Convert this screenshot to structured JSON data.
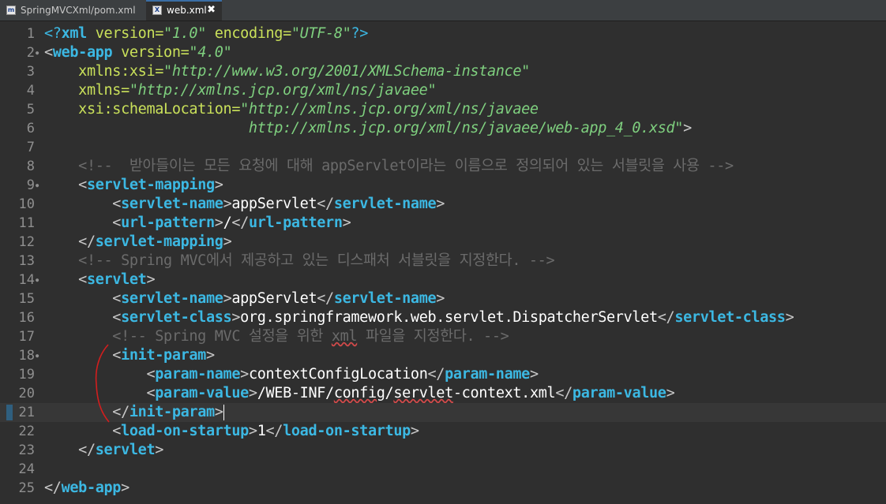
{
  "tabs": [
    {
      "label": "SpringMVCXml/pom.xml",
      "icon": "maven-file-icon"
    },
    {
      "label": "web.xml",
      "icon": "xml-file-icon",
      "close": "✖"
    }
  ],
  "editor": {
    "lines": [
      {
        "n": "1",
        "tokens": [
          {
            "c": "pi",
            "t": "<?"
          },
          {
            "c": "tg",
            "t": "xml"
          },
          {
            "c": "at",
            "t": " version="
          },
          {
            "c": "av",
            "t": "\"1.0\""
          },
          {
            "c": "at",
            "t": " encoding="
          },
          {
            "c": "av",
            "t": "\"UTF-8\""
          },
          {
            "c": "pi",
            "t": "?>"
          }
        ]
      },
      {
        "n": "2",
        "fold": true,
        "tokens": [
          {
            "c": "pu",
            "t": "<"
          },
          {
            "c": "tg",
            "t": "web-app"
          },
          {
            "c": "at",
            "t": " version="
          },
          {
            "c": "av",
            "t": "\"4.0\""
          }
        ]
      },
      {
        "n": "3",
        "tokens": [
          {
            "c": "at",
            "t": "    xmlns:xsi="
          },
          {
            "c": "av",
            "t": "\"http://www.w3.org/2001/XMLSchema-instance\""
          }
        ]
      },
      {
        "n": "4",
        "tokens": [
          {
            "c": "at",
            "t": "    xmlns="
          },
          {
            "c": "av",
            "t": "\"http://xmlns.jcp.org/xml/ns/javaee\""
          }
        ]
      },
      {
        "n": "5",
        "tokens": [
          {
            "c": "at",
            "t": "    xsi:schemaLocation="
          },
          {
            "c": "av",
            "t": "\"http://xmlns.jcp.org/xml/ns/javaee"
          }
        ]
      },
      {
        "n": "6",
        "tokens": [
          {
            "c": "av",
            "t": "                        http://xmlns.jcp.org/xml/ns/javaee/web-app_4_0.xsd\""
          },
          {
            "c": "pu",
            "t": ">"
          }
        ]
      },
      {
        "n": "7",
        "tokens": []
      },
      {
        "n": "8",
        "tokens": [
          {
            "c": "cm",
            "t": "    <!--  받아들이는 모든 요청에 대해 appServlet이라는 이름으로 정의되어 있는 서블릿을 사용 -->"
          }
        ]
      },
      {
        "n": "9",
        "fold": true,
        "tokens": [
          {
            "c": "pu",
            "t": "    <"
          },
          {
            "c": "tg",
            "t": "servlet-mapping"
          },
          {
            "c": "pu",
            "t": ">"
          }
        ]
      },
      {
        "n": "10",
        "tokens": [
          {
            "c": "pu",
            "t": "        <"
          },
          {
            "c": "tg",
            "t": "servlet-name"
          },
          {
            "c": "pu",
            "t": ">"
          },
          {
            "c": "tx",
            "t": "appServlet"
          },
          {
            "c": "pu",
            "t": "</"
          },
          {
            "c": "tg",
            "t": "servlet-name"
          },
          {
            "c": "pu",
            "t": ">"
          }
        ]
      },
      {
        "n": "11",
        "tokens": [
          {
            "c": "pu",
            "t": "        <"
          },
          {
            "c": "tg",
            "t": "url-pattern"
          },
          {
            "c": "pu",
            "t": ">"
          },
          {
            "c": "tx",
            "t": "/"
          },
          {
            "c": "pu",
            "t": "</"
          },
          {
            "c": "tg",
            "t": "url-pattern"
          },
          {
            "c": "pu",
            "t": ">"
          }
        ]
      },
      {
        "n": "12",
        "tokens": [
          {
            "c": "pu",
            "t": "    </"
          },
          {
            "c": "tg",
            "t": "servlet-mapping"
          },
          {
            "c": "pu",
            "t": ">"
          }
        ]
      },
      {
        "n": "13",
        "tokens": [
          {
            "c": "cm",
            "t": "    <!-- Spring MVC에서 제공하고 있는 디스패처 서블릿을 지정한다. -->"
          }
        ]
      },
      {
        "n": "14",
        "fold": true,
        "tokens": [
          {
            "c": "pu",
            "t": "    <"
          },
          {
            "c": "tg",
            "t": "servlet"
          },
          {
            "c": "pu",
            "t": ">"
          }
        ]
      },
      {
        "n": "15",
        "tokens": [
          {
            "c": "pu",
            "t": "        <"
          },
          {
            "c": "tg",
            "t": "servlet-name"
          },
          {
            "c": "pu",
            "t": ">"
          },
          {
            "c": "tx",
            "t": "appServlet"
          },
          {
            "c": "pu",
            "t": "</"
          },
          {
            "c": "tg",
            "t": "servlet-name"
          },
          {
            "c": "pu",
            "t": ">"
          }
        ]
      },
      {
        "n": "16",
        "tokens": [
          {
            "c": "pu",
            "t": "        <"
          },
          {
            "c": "tg",
            "t": "servlet-class"
          },
          {
            "c": "pu",
            "t": ">"
          },
          {
            "c": "tx",
            "t": "org.springframework.web.servlet.DispatcherServlet"
          },
          {
            "c": "pu",
            "t": "</"
          },
          {
            "c": "tg",
            "t": "servlet-class"
          },
          {
            "c": "pu",
            "t": ">"
          }
        ]
      },
      {
        "n": "17",
        "tokens": [
          {
            "c": "cm",
            "t": "        <!-- Spring MVC 설정을 위한 "
          },
          {
            "c": "cm sq",
            "t": "xml"
          },
          {
            "c": "cm",
            "t": " 파일을 지정한다. -->"
          }
        ]
      },
      {
        "n": "18",
        "fold": true,
        "tokens": [
          {
            "c": "pu",
            "t": "        <"
          },
          {
            "c": "tg",
            "t": "init-param"
          },
          {
            "c": "pu",
            "t": ">"
          }
        ]
      },
      {
        "n": "19",
        "tokens": [
          {
            "c": "pu",
            "t": "            <"
          },
          {
            "c": "tg",
            "t": "param-name"
          },
          {
            "c": "pu",
            "t": ">"
          },
          {
            "c": "tx",
            "t": "contextConfigLocation"
          },
          {
            "c": "pu",
            "t": "</"
          },
          {
            "c": "tg",
            "t": "param-name"
          },
          {
            "c": "pu",
            "t": ">"
          }
        ]
      },
      {
        "n": "20",
        "tokens": [
          {
            "c": "pu",
            "t": "            <"
          },
          {
            "c": "tg",
            "t": "param-value"
          },
          {
            "c": "pu",
            "t": ">"
          },
          {
            "c": "tx",
            "t": "/WEB-INF/"
          },
          {
            "c": "tx sq",
            "t": "config"
          },
          {
            "c": "tx",
            "t": "/"
          },
          {
            "c": "tx sq",
            "t": "servlet"
          },
          {
            "c": "tx",
            "t": "-context.xml"
          },
          {
            "c": "pu",
            "t": "</"
          },
          {
            "c": "tg",
            "t": "param-value"
          },
          {
            "c": "pu",
            "t": ">"
          }
        ]
      },
      {
        "n": "21",
        "current": true,
        "tokens": [
          {
            "c": "pu",
            "t": "        </"
          },
          {
            "c": "tg",
            "t": "init-param"
          },
          {
            "c": "pu",
            "t": ">"
          },
          {
            "c": "caret",
            "t": ""
          }
        ]
      },
      {
        "n": "22",
        "tokens": [
          {
            "c": "pu",
            "t": "        <"
          },
          {
            "c": "tg",
            "t": "load-on-startup"
          },
          {
            "c": "pu",
            "t": ">"
          },
          {
            "c": "tx",
            "t": "1"
          },
          {
            "c": "pu",
            "t": "</"
          },
          {
            "c": "tg",
            "t": "load-on-startup"
          },
          {
            "c": "pu",
            "t": ">"
          }
        ]
      },
      {
        "n": "23",
        "tokens": [
          {
            "c": "pu",
            "t": "    </"
          },
          {
            "c": "tg",
            "t": "servlet"
          },
          {
            "c": "pu",
            "t": ">"
          }
        ]
      },
      {
        "n": "24",
        "tokens": []
      },
      {
        "n": "25",
        "tokens": [
          {
            "c": "pu",
            "t": "</"
          },
          {
            "c": "tg",
            "t": "web-app"
          },
          {
            "c": "pu",
            "t": ">"
          }
        ]
      }
    ]
  },
  "colors": {
    "background": "#2f2f2f",
    "tag": "#3cb8e3",
    "attribute": "#c9e05a",
    "attribute_value": "#7fd07f",
    "comment": "#6b6b6b",
    "annotation_stroke": "#d21e1e"
  }
}
